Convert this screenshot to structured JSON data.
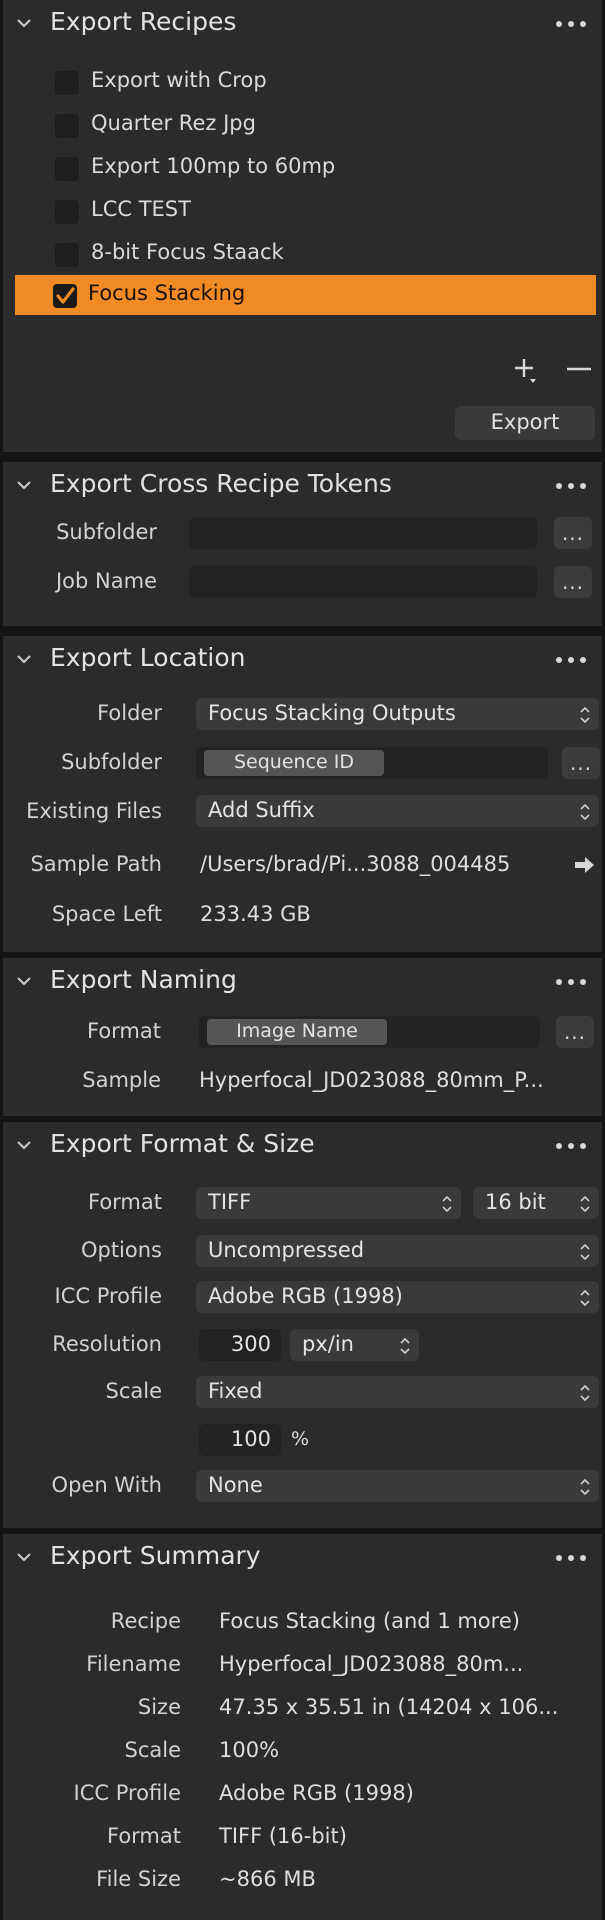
{
  "recipes": {
    "title": "Export Recipes",
    "items": [
      {
        "label": "Export with Crop",
        "checked": false
      },
      {
        "label": "Quarter Rez Jpg",
        "checked": false
      },
      {
        "label": "Export 100mp to 60mp",
        "checked": false
      },
      {
        "label": "LCC TEST",
        "checked": false
      },
      {
        "label": "8-bit Focus Staack",
        "checked": false
      },
      {
        "label": "Focus Stacking",
        "checked": true
      }
    ],
    "add_symbol": "+",
    "remove_symbol": "−",
    "export_label": "Export",
    "accent_color": "#f08a24"
  },
  "tokens": {
    "title": "Export Cross Recipe Tokens",
    "subfolder_label": "Subfolder",
    "subfolder_value": "",
    "jobname_label": "Job Name",
    "jobname_value": "",
    "more_label": "..."
  },
  "location": {
    "title": "Export Location",
    "folder_label": "Folder",
    "folder_value": "Focus Stacking Outputs",
    "subfolder_label": "Subfolder",
    "subfolder_token": "Sequence ID",
    "existing_label": "Existing Files",
    "existing_value": "Add Suffix",
    "sample_label": "Sample Path",
    "sample_value": "/Users/brad/Pi...3088_004485",
    "space_label": "Space Left",
    "space_value": "233.43 GB",
    "more_label": "..."
  },
  "naming": {
    "title": "Export Naming",
    "format_label": "Format",
    "format_token": "Image Name",
    "sample_label": "Sample",
    "sample_value": "Hyperfocal_JD023088_80mm_P...",
    "more_label": "..."
  },
  "format": {
    "title": "Export Format & Size",
    "format_label": "Format",
    "format_value": "TIFF",
    "bitdepth_value": "16 bit",
    "options_label": "Options",
    "options_value": "Uncompressed",
    "icc_label": "ICC Profile",
    "icc_value": "Adobe RGB (1998)",
    "resolution_label": "Resolution",
    "resolution_value": "300",
    "resolution_unit": "px/in",
    "scale_label": "Scale",
    "scale_value": "Fixed",
    "scale_percent": "100",
    "percent_sign": "%",
    "openwith_label": "Open With",
    "openwith_value": "None"
  },
  "summary": {
    "title": "Export Summary",
    "rows": [
      {
        "label": "Recipe",
        "value": "Focus Stacking (and 1 more)"
      },
      {
        "label": "Filename",
        "value": "Hyperfocal_JD023088_80m..."
      },
      {
        "label": "Size",
        "value": "47.35 x 35.51 in (14204 x 106..."
      },
      {
        "label": "Scale",
        "value": "100%"
      },
      {
        "label": "ICC Profile",
        "value": "Adobe RGB (1998)"
      },
      {
        "label": "Format",
        "value": "TIFF (16-bit)"
      },
      {
        "label": "File Size",
        "value": "~866 MB"
      }
    ]
  }
}
